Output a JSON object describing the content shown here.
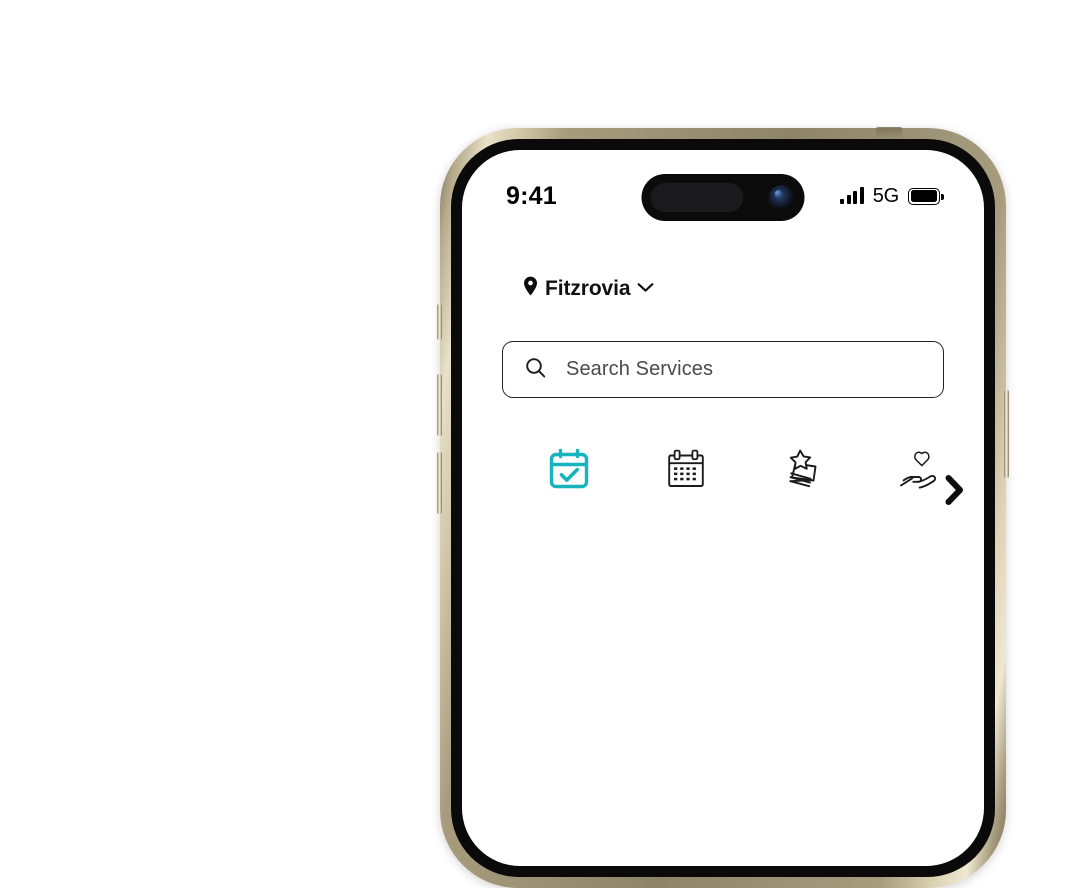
{
  "device": {
    "name": "iphone-15-pro-natural-titanium",
    "frame_color": "#a79c7d",
    "bezel_color": "#0a0a0a",
    "screen_color": "#ffffff"
  },
  "status_bar": {
    "time": "9:41",
    "signal_bars": 4,
    "network": "5G",
    "battery_full": true
  },
  "app": {
    "accent_color": "#16b5bd",
    "location": {
      "name": "Fitzrovia",
      "pin_icon": "location-pin-icon",
      "chevron_icon": "chevron-down-icon"
    },
    "search": {
      "placeholder": "Search Services",
      "icon": "search-icon",
      "value": ""
    },
    "categories": [
      {
        "icon": "calendar-check-icon",
        "active": true
      },
      {
        "icon": "calendar-icon",
        "active": false
      },
      {
        "icon": "star-card-stack-icon",
        "active": false
      },
      {
        "icon": "hand-heart-icon",
        "active": false
      }
    ],
    "carousel": {
      "next_icon": "chevron-right-icon"
    }
  }
}
